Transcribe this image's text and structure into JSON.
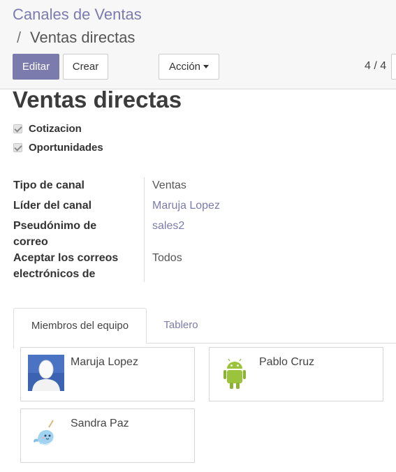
{
  "breadcrumb": {
    "root": "Canales de Ventas",
    "separator": "/",
    "current": "Ventas directas"
  },
  "toolbar": {
    "edit_label": "Editar",
    "create_label": "Crear",
    "action_label": "Acción"
  },
  "pager": {
    "value": "4 / 4"
  },
  "record": {
    "title": "Ventas directas",
    "options": [
      {
        "label": "Cotizacion",
        "checked": true
      },
      {
        "label": "Oportunidades",
        "checked": true
      }
    ],
    "fields": [
      {
        "label": "Tipo de canal",
        "value": "Ventas"
      },
      {
        "label": "Líder del canal",
        "value": "Maruja Lopez"
      },
      {
        "label": "Pseudónimo de correo",
        "value": "sales2"
      },
      {
        "label": "Aceptar los correos electrónicos de",
        "value": "Todos"
      }
    ]
  },
  "tabs": [
    {
      "label": "Miembros del equipo",
      "active": true
    },
    {
      "label": "Tablero",
      "active": false
    }
  ],
  "members": [
    {
      "name": "Maruja Lopez",
      "avatar": "user-silhouette-avatar"
    },
    {
      "name": "Pablo Cruz",
      "avatar": "android-avatar"
    },
    {
      "name": "Sandra Paz",
      "avatar": "narwhal-avatar"
    }
  ],
  "colors": {
    "accent": "#7c7bad",
    "panel": "#f7f7f7"
  }
}
